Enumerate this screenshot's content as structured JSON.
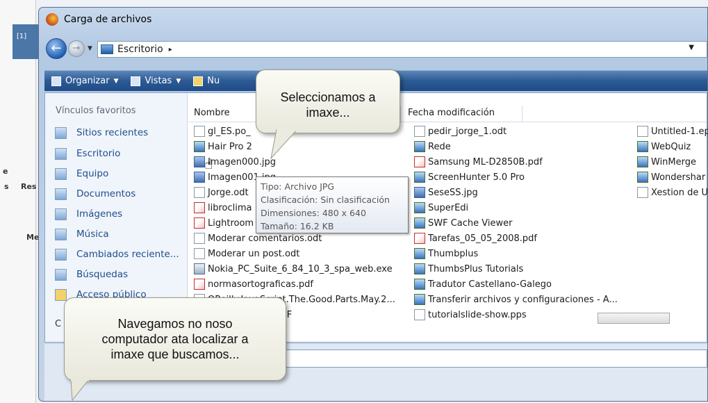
{
  "window": {
    "title": "Carga de archivos"
  },
  "background": {
    "tab_label": "[1]",
    "frag1": "e",
    "frag2": "s",
    "frag3": "Res",
    "frag4": "Me"
  },
  "address": {
    "location": "Escritorio",
    "separator": "▸"
  },
  "toolbar": {
    "organize": "Organizar",
    "views": "Vistas",
    "new_folder": "Nu"
  },
  "sidebar": {
    "heading": "Vínculos favoritos",
    "items": [
      {
        "label": "Sitios recientes"
      },
      {
        "label": "Escritorio"
      },
      {
        "label": "Equipo"
      },
      {
        "label": "Documentos"
      },
      {
        "label": "Imágenes"
      },
      {
        "label": "Música"
      },
      {
        "label": "Cambiados reciente..."
      },
      {
        "label": "Búsquedas"
      },
      {
        "label": "Acceso público"
      }
    ],
    "clipped_label": "C"
  },
  "columns": {
    "name": "Nombre",
    "modified": "Fecha modificación"
  },
  "files_col1": [
    {
      "name": "gl_ES.po_",
      "type": "doc"
    },
    {
      "name": "Hair Pro 2",
      "type": "lnk"
    },
    {
      "name": "Imagen000.jpg",
      "type": "img"
    },
    {
      "name": "Imagen001.jpg",
      "type": "img"
    },
    {
      "name": "Jorge.odt",
      "type": "doc"
    },
    {
      "name": "libroclima",
      "type": "pdf"
    },
    {
      "name": "Lightroom",
      "type": "pdf"
    },
    {
      "name": "Moderar comentarios.odt",
      "type": "doc"
    },
    {
      "name": "Moderar un post.odt",
      "type": "doc"
    },
    {
      "name": "Nokia_PC_Suite_6_84_10_3_spa_web.exe",
      "type": "exe"
    },
    {
      "name": "normasortograficas.pdf",
      "type": "pdf"
    },
    {
      "name": "OReilly.JavaScript.The.Good.Parts.May.2...",
      "type": "doc"
    },
    {
      "name": "enteCompleto.PDF",
      "type": "pdf"
    }
  ],
  "files_col2": [
    {
      "name": "pedir_jorge_1.odt",
      "type": "doc"
    },
    {
      "name": "Rede",
      "type": "lnk"
    },
    {
      "name": "Samsung ML-D2850B.pdf",
      "type": "pdf"
    },
    {
      "name": "ScreenHunter 5.0 Pro",
      "type": "lnk"
    },
    {
      "name": "SeseSS.jpg",
      "type": "img"
    },
    {
      "name": "SuperEdi",
      "type": "lnk"
    },
    {
      "name": "SWF Cache Viewer",
      "type": "lnk"
    },
    {
      "name": "Tarefas_05_05_2008.pdf",
      "type": "pdf"
    },
    {
      "name": "Thumbplus",
      "type": "lnk"
    },
    {
      "name": "ThumbsPlus Tutorials",
      "type": "lnk"
    },
    {
      "name": "Tradutor Castellano-Galego",
      "type": "lnk"
    },
    {
      "name": "Transferir archivos y configuraciones - A...",
      "type": "lnk"
    },
    {
      "name": "tutorialslide-show.pps",
      "type": "doc"
    }
  ],
  "files_col3": [
    {
      "name": "Untitled-1.ep",
      "type": "doc"
    },
    {
      "name": "WebQuiz",
      "type": "lnk"
    },
    {
      "name": "WinMerge",
      "type": "lnk"
    },
    {
      "name": "Wondershar",
      "type": "lnk"
    },
    {
      "name": "Xestion de U",
      "type": "doc"
    }
  ],
  "tooltip": {
    "type": "Tipo: Archivo JPG",
    "rating": "Clasificación: Sin clasificación",
    "dimensions": "Dimensiones: 480 x 640",
    "size": "Tamaño: 16.2 KB"
  },
  "callouts": {
    "select_line1": "Seleccionamos a",
    "select_line2": "imaxe...",
    "navigate_line1": "Navegamos no noso",
    "navigate_line2": "computador ata localizar a",
    "navigate_line3": "imaxe que buscamos..."
  }
}
